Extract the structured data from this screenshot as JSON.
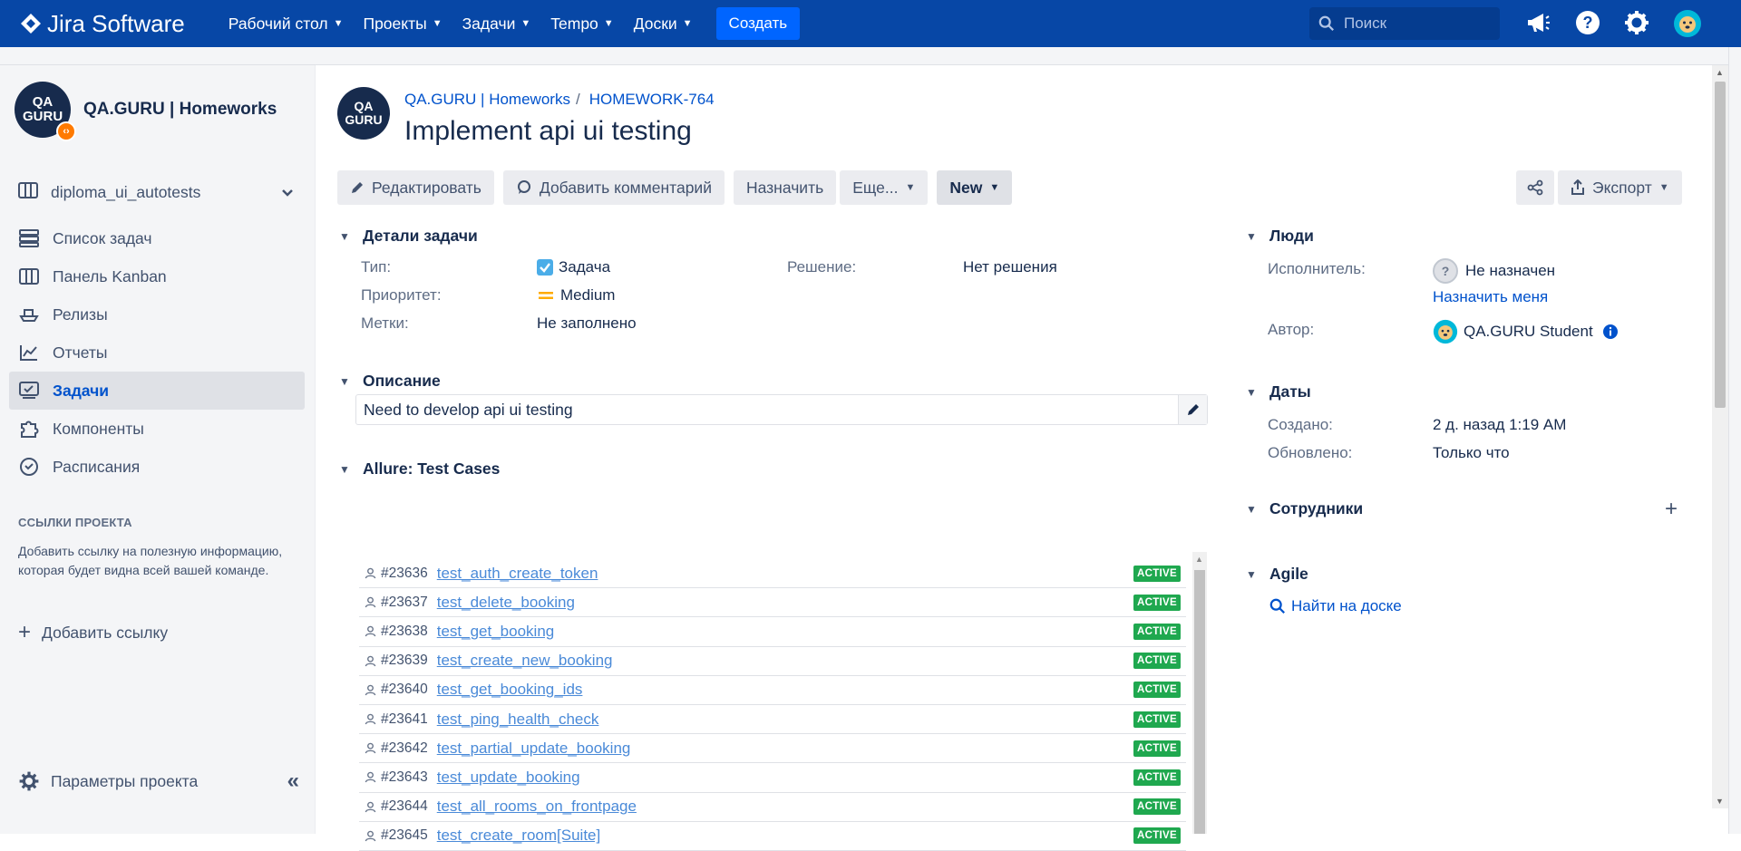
{
  "nav": {
    "product": "Jira Software",
    "items": [
      "Рабочий стол",
      "Проекты",
      "Задачи",
      "Tempo",
      "Доски"
    ],
    "create": "Создать",
    "search_placeholder": "Поиск"
  },
  "sidebar": {
    "project_name": "QA.GURU | Homeworks",
    "avatar_text": "QA GURU",
    "board": "diploma_ui_autotests",
    "items": [
      {
        "label": "Список задач",
        "icon": "backlog-icon"
      },
      {
        "label": "Панель Kanban",
        "icon": "board-icon"
      },
      {
        "label": "Релизы",
        "icon": "ship-icon"
      },
      {
        "label": "Отчеты",
        "icon": "chart-icon"
      },
      {
        "label": "Задачи",
        "icon": "issues-icon"
      },
      {
        "label": "Компоненты",
        "icon": "puzzle-icon"
      },
      {
        "label": "Расписания",
        "icon": "clock-icon"
      }
    ],
    "links_heading": "ССЫЛКИ ПРОЕКТА",
    "links_text": "Добавить ссылку на полезную информацию, которая будет видна всей вашей команде.",
    "add_link": "Добавить ссылку",
    "settings": "Параметры проекта"
  },
  "issue": {
    "breadcrumb_project": "QA.GURU | Homeworks",
    "breadcrumb_key": "HOMEWORK-764",
    "title": "Implement api ui testing",
    "toolbar": {
      "edit": "Редактировать",
      "comment": "Добавить комментарий",
      "assign": "Назначить",
      "more": "Еще...",
      "status": "New",
      "export": "Экспорт"
    },
    "details": {
      "heading": "Детали задачи",
      "type_label": "Тип:",
      "type_value": "Задача",
      "priority_label": "Приоритет:",
      "priority_value": "Medium",
      "labels_label": "Метки:",
      "labels_value": "Не заполнено",
      "resolution_label": "Решение:",
      "resolution_value": "Нет решения"
    },
    "description": {
      "heading": "Описание",
      "text": "Need to develop api ui testing"
    },
    "allure": {
      "heading": "Allure: Test Cases",
      "cases": [
        {
          "id": "#23636",
          "name": "test_auth_create_token",
          "status": "ACTIVE"
        },
        {
          "id": "#23637",
          "name": "test_delete_booking",
          "status": "ACTIVE"
        },
        {
          "id": "#23638",
          "name": "test_get_booking",
          "status": "ACTIVE"
        },
        {
          "id": "#23639",
          "name": "test_create_new_booking",
          "status": "ACTIVE"
        },
        {
          "id": "#23640",
          "name": "test_get_booking_ids",
          "status": "ACTIVE"
        },
        {
          "id": "#23641",
          "name": "test_ping_health_check",
          "status": "ACTIVE"
        },
        {
          "id": "#23642",
          "name": "test_partial_update_booking",
          "status": "ACTIVE"
        },
        {
          "id": "#23643",
          "name": "test_update_booking",
          "status": "ACTIVE"
        },
        {
          "id": "#23644",
          "name": "test_all_rooms_on_frontpage",
          "status": "ACTIVE"
        },
        {
          "id": "#23645",
          "name": "test_create_room[Suite]",
          "status": "ACTIVE"
        }
      ]
    },
    "people": {
      "heading": "Люди",
      "assignee_label": "Исполнитель:",
      "assignee_value": "Не назначен",
      "assign_me": "Назначить меня",
      "author_label": "Автор:",
      "author_value": "QA.GURU Student"
    },
    "dates": {
      "heading": "Даты",
      "created_label": "Создано:",
      "created_value": "2 д. назад 1:19 AM",
      "updated_label": "Обновлено:",
      "updated_value": "Только что"
    },
    "employees": {
      "heading": "Сотрудники"
    },
    "agile": {
      "heading": "Agile",
      "find_on_board": "Найти на доске"
    }
  },
  "colors": {
    "nav_bg": "#0747a6",
    "create_btn": "#0065ff",
    "active_badge": "#1fa84f",
    "link": "#0052cc"
  }
}
